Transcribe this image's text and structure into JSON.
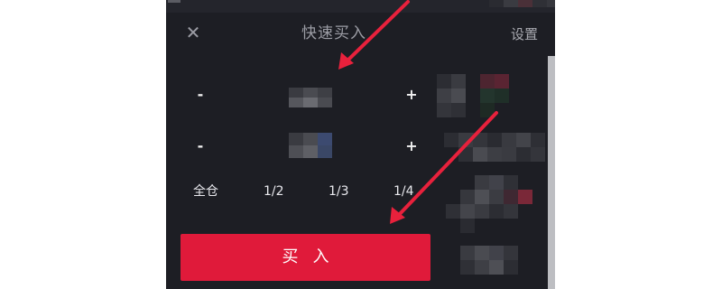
{
  "header": {
    "close_glyph": "✕",
    "title": "快速买入",
    "settings_label": "设置"
  },
  "steppers": [
    {
      "minus": "-",
      "plus": "+"
    },
    {
      "minus": "-",
      "plus": "+"
    }
  ],
  "percent_options": [
    "全仓",
    "1/2",
    "1/3",
    "1/4"
  ],
  "buy_button": {
    "label": "买入"
  },
  "colors": {
    "background": "#1d1e24",
    "buy_button": "#e01a3a",
    "annotation_arrow": "#e8213c",
    "title_text": "#9b9ca4"
  },
  "icons": [
    "close-icon",
    "minus-icon",
    "plus-icon",
    "annotation-arrow"
  ]
}
